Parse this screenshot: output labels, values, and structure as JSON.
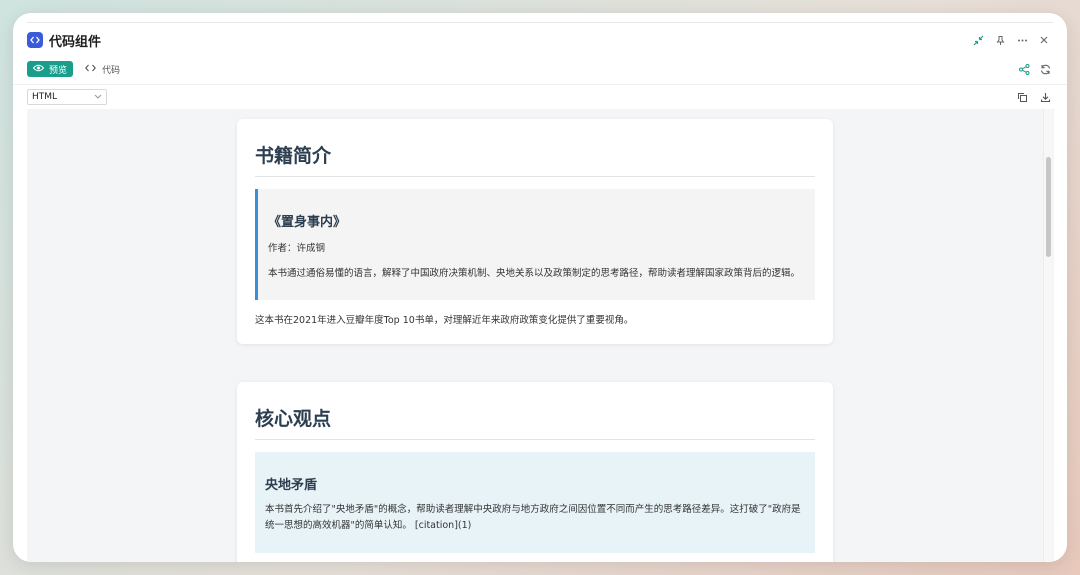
{
  "window": {
    "title": "代码组件"
  },
  "toolbar": {
    "preview_label": "预览",
    "code_label": "代码"
  },
  "subbar": {
    "language": "HTML"
  },
  "content": {
    "intro": {
      "heading": "书籍简介",
      "book_title": "《置身事内》",
      "author": "作者：许成钢",
      "description": "本书通过通俗易懂的语言，解释了中国政府决策机制、央地关系以及政策制定的思考路径，帮助读者理解国家政策背后的逻辑。",
      "note": "这本书在2021年进入豆瓣年度Top 10书单，对理解近年来政府政策变化提供了重要视角。"
    },
    "core": {
      "heading": "核心观点",
      "point_title": "央地矛盾",
      "point_desc": "本书首先介绍了\"央地矛盾\"的概念，帮助读者理解中央政府与地方政府之间因位置不同而产生的思考路径差异。这打破了\"政府是统一思想的高效机器\"的简单认知。 [citation](1)"
    }
  },
  "colors": {
    "accent": "#1a9e8c",
    "app_icon": "#3b5bdb",
    "quote_border": "#3a8fd8"
  },
  "icons": {
    "app": "code-brackets-icon",
    "minimize": "collapse-icon",
    "pin": "pin-icon",
    "more": "more-icon",
    "close": "close-icon",
    "preview": "eye-icon",
    "code": "code-icon",
    "share": "share-icon",
    "refresh": "refresh-icon",
    "copy": "copy-icon",
    "download": "download-icon",
    "dropdown": "chevron-down-icon"
  }
}
